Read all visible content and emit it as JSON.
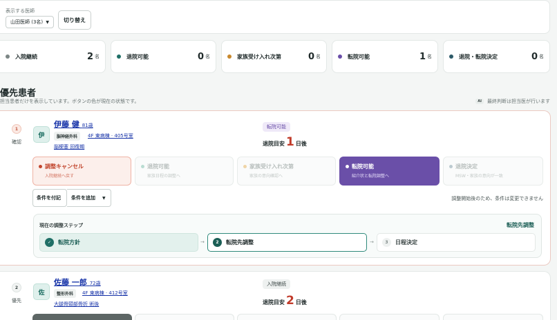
{
  "doctor": {
    "label": "表示する医師",
    "selected": "山田医師 (3名)",
    "switch_label": "切り替え"
  },
  "stats": [
    {
      "label": "入院継続",
      "count": "2",
      "unit": "名",
      "color": "#7c8685"
    },
    {
      "label": "退院可能",
      "count": "0",
      "unit": "名",
      "color": "#1f6f66"
    },
    {
      "label": "家族受け入れ次第",
      "count": "0",
      "unit": "名",
      "color": "#c9892e"
    },
    {
      "label": "転院可能",
      "count": "1",
      "unit": "名",
      "color": "#6a4fa8"
    },
    {
      "label": "退院・転院決定",
      "count": "0",
      "unit": "名",
      "color": "#2d5a68"
    }
  ],
  "section": {
    "title": "優先患者",
    "subtitle": "担当患者だけを表示しています。ボタンの色が現在の状態です。",
    "ai_badge": "AI",
    "ai_note": "最終判断は担当医が行います"
  },
  "patients": [
    {
      "rank": "1",
      "rank_label": "確認",
      "avatar": "伊",
      "name": "伊藤 健",
      "age": "81歳",
      "dept": "脳神経外科",
      "ward": "4F 東病棟 · 405号室",
      "diagnosis": "脳梗塞 回復期",
      "status": "転院可能",
      "eta_prefix": "退院目安",
      "eta_num": "1",
      "eta_suffix": "日後",
      "steps": [
        {
          "title": "調整キャンセル",
          "desc": "入院継続へ戻す"
        },
        {
          "title": "退院可能",
          "desc": "家族日程の調整へ"
        },
        {
          "title": "家族受け入れ次第",
          "desc": "家族の意向確認へ"
        },
        {
          "title": "転院可能",
          "desc": "紹介状と転院調整へ"
        },
        {
          "title": "退院決定",
          "desc": "MSW・家族の意向が一致"
        }
      ],
      "condition_button": "条件を付記",
      "condition_select": "条件を追加",
      "condition_note": "調整開始後のため、条件は変更できません",
      "flow": {
        "title": "現在の調整ステップ",
        "current": "転院先調整",
        "steps": [
          {
            "num": "✓",
            "label": "転院方針"
          },
          {
            "num": "2",
            "label": "転院先調整"
          },
          {
            "num": "3",
            "label": "日程決定"
          }
        ]
      }
    },
    {
      "rank": "2",
      "rank_label": "優先",
      "avatar": "佐",
      "name": "佐藤 一郎",
      "age": "72歳",
      "dept": "整形外科",
      "ward": "4F 東病棟 · 412号室",
      "diagnosis": "大腿骨頸部骨折 術後",
      "status": "入院継続",
      "eta_prefix": "退院目安",
      "eta_num": "2",
      "eta_suffix": "日後"
    }
  ]
}
